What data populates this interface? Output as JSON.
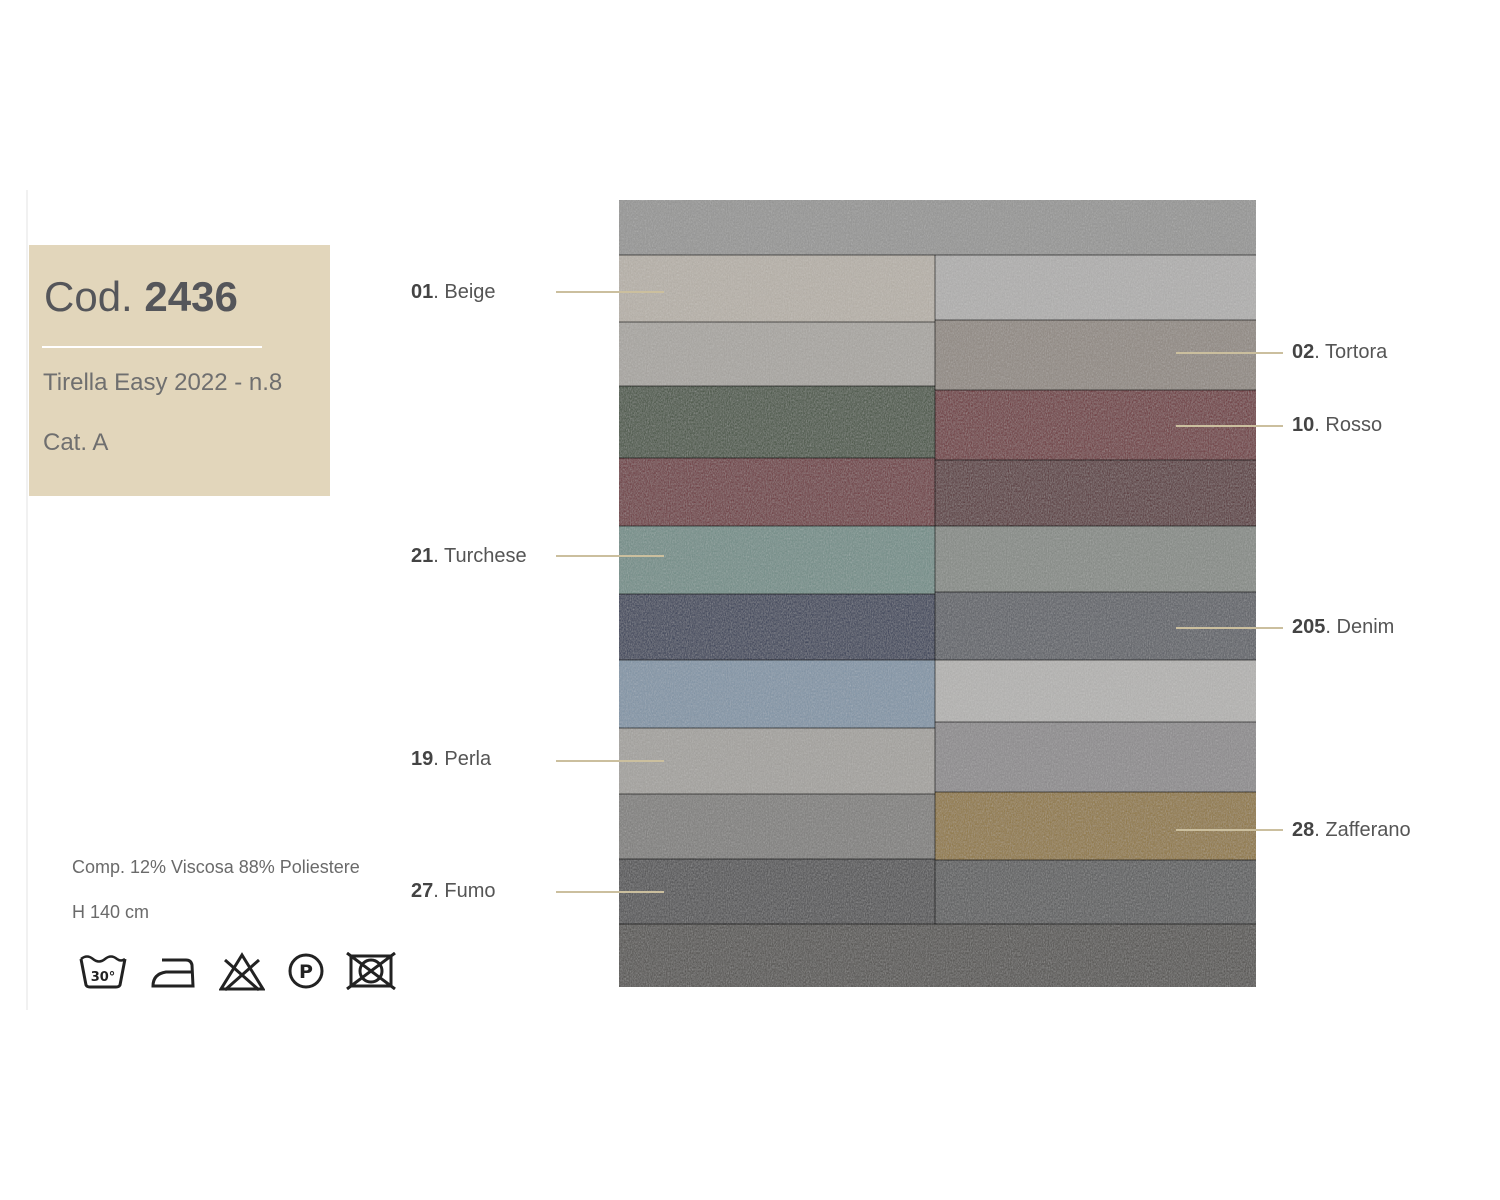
{
  "header": {
    "code_prefix": "Cod.",
    "code_number": "2436",
    "collection": "Tirella Easy 2022 - n.8",
    "category": "Cat. A"
  },
  "specs": {
    "composition": "Comp. 12% Viscosa 88% Poliestere",
    "height": "H 140 cm",
    "wash_temp": "30°"
  },
  "care_icons": [
    "wash-30-icon",
    "iron-icon",
    "no-bleach-icon",
    "dry-clean-p-icon",
    "no-tumble-dry-icon"
  ],
  "swatches": [
    {
      "code": "01",
      "name": "Beige"
    },
    {
      "code": "02",
      "name": "Tortora"
    },
    {
      "code": "10",
      "name": "Rosso"
    },
    {
      "code": "21",
      "name": "Turchese"
    },
    {
      "code": "205",
      "name": "Denim"
    },
    {
      "code": "19",
      "name": "Perla"
    },
    {
      "code": "28",
      "name": "Zafferano"
    },
    {
      "code": "27",
      "name": "Fumo"
    }
  ],
  "colors": {
    "code_box": "#e2d6bb",
    "leader_line": "#cbbf9e",
    "beige": "#b7b1a8",
    "tortora": "#8f8780",
    "rosso": "#6b2a31",
    "turchese": "#6f8c86",
    "denim": "#585b62",
    "perla": "#a3a19d",
    "zafferano": "#8f7538",
    "fumo": "#4a4a4c"
  }
}
